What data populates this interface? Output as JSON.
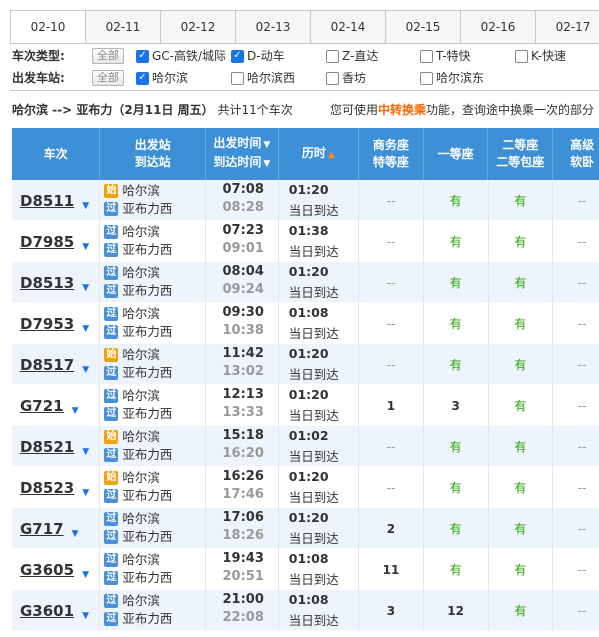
{
  "dates": [
    "02-10",
    "02-11",
    "02-12",
    "02-13",
    "02-14",
    "02-15",
    "02-16",
    "02-17"
  ],
  "filters": {
    "type_label": "车次类型:",
    "station_label": "出发车站:",
    "all_label": "全部",
    "types": [
      {
        "label": "GC-高铁/城际",
        "checked": true
      },
      {
        "label": "D-动车",
        "checked": true
      },
      {
        "label": "Z-直达",
        "checked": false
      },
      {
        "label": "T-特快",
        "checked": false
      },
      {
        "label": "K-快速",
        "checked": false
      }
    ],
    "stations": [
      {
        "label": "哈尔滨",
        "checked": true
      },
      {
        "label": "哈尔滨西",
        "checked": false
      },
      {
        "label": "香坊",
        "checked": false
      },
      {
        "label": "哈尔滨东",
        "checked": false
      }
    ]
  },
  "summary": {
    "route": "哈尔滨 --> 亚布力（2月11日  周五）",
    "count": "共计11个车次",
    "tip_pre": "您可使用",
    "tip_hl": "中转换乘",
    "tip_post": "功能，查询途中换乘一次的部分"
  },
  "headers": {
    "train": "车次",
    "station_1": "出发站",
    "station_2": "到达站",
    "time_1": "出发时间",
    "time_2": "到达时间",
    "duration": "历时",
    "biz_1": "商务座",
    "biz_2": "特等座",
    "first": "一等座",
    "second_1": "二等座",
    "second_2": "二等包座",
    "high_1": "高级",
    "high_2": "软卧"
  },
  "rows": [
    {
      "no": "D8511",
      "from_badge": "始",
      "from": "哈尔滨",
      "to_badge": "过",
      "to": "亚布力西",
      "dep": "07:08",
      "arr": "08:28",
      "dur": "01:20",
      "day": "当日到达",
      "biz": "--",
      "first": "有",
      "second": "有"
    },
    {
      "no": "D7985",
      "from_badge": "过",
      "from": "哈尔滨",
      "to_badge": "过",
      "to": "亚布力西",
      "dep": "07:23",
      "arr": "09:01",
      "dur": "01:38",
      "day": "当日到达",
      "biz": "--",
      "first": "有",
      "second": "有"
    },
    {
      "no": "D8513",
      "from_badge": "过",
      "from": "哈尔滨",
      "to_badge": "过",
      "to": "亚布力西",
      "dep": "08:04",
      "arr": "09:24",
      "dur": "01:20",
      "day": "当日到达",
      "biz": "--",
      "first": "有",
      "second": "有"
    },
    {
      "no": "D7953",
      "from_badge": "过",
      "from": "哈尔滨",
      "to_badge": "过",
      "to": "亚布力西",
      "dep": "09:30",
      "arr": "10:38",
      "dur": "01:08",
      "day": "当日到达",
      "biz": "--",
      "first": "有",
      "second": "有"
    },
    {
      "no": "D8517",
      "from_badge": "始",
      "from": "哈尔滨",
      "to_badge": "过",
      "to": "亚布力西",
      "dep": "11:42",
      "arr": "13:02",
      "dur": "01:20",
      "day": "当日到达",
      "biz": "--",
      "first": "有",
      "second": "有"
    },
    {
      "no": "G721",
      "from_badge": "过",
      "from": "哈尔滨",
      "to_badge": "过",
      "to": "亚布力西",
      "dep": "12:13",
      "arr": "13:33",
      "dur": "01:20",
      "day": "当日到达",
      "biz": "1",
      "first": "3",
      "second": "有"
    },
    {
      "no": "D8521",
      "from_badge": "始",
      "from": "哈尔滨",
      "to_badge": "过",
      "to": "亚布力西",
      "dep": "15:18",
      "arr": "16:20",
      "dur": "01:02",
      "day": "当日到达",
      "biz": "--",
      "first": "有",
      "second": "有"
    },
    {
      "no": "D8523",
      "from_badge": "始",
      "from": "哈尔滨",
      "to_badge": "过",
      "to": "亚布力西",
      "dep": "16:26",
      "arr": "17:46",
      "dur": "01:20",
      "day": "当日到达",
      "biz": "--",
      "first": "有",
      "second": "有"
    },
    {
      "no": "G717",
      "from_badge": "过",
      "from": "哈尔滨",
      "to_badge": "过",
      "to": "亚布力西",
      "dep": "17:06",
      "arr": "18:26",
      "dur": "01:20",
      "day": "当日到达",
      "biz": "2",
      "first": "有",
      "second": "有"
    },
    {
      "no": "G3605",
      "from_badge": "过",
      "from": "哈尔滨",
      "to_badge": "过",
      "to": "亚布力西",
      "dep": "19:43",
      "arr": "20:51",
      "dur": "01:08",
      "day": "当日到达",
      "biz": "11",
      "first": "有",
      "second": "有"
    },
    {
      "no": "G3601",
      "from_badge": "过",
      "from": "哈尔滨",
      "to_badge": "过",
      "to": "亚布力西",
      "dep": "21:00",
      "arr": "22:08",
      "dur": "01:08",
      "day": "当日到达",
      "biz": "3",
      "first": "12",
      "second": "有"
    }
  ],
  "high_placeholder": "--",
  "colors": {
    "header_bg": "#3d8fd6",
    "available": "#26a306",
    "highlight": "#ff6600"
  }
}
